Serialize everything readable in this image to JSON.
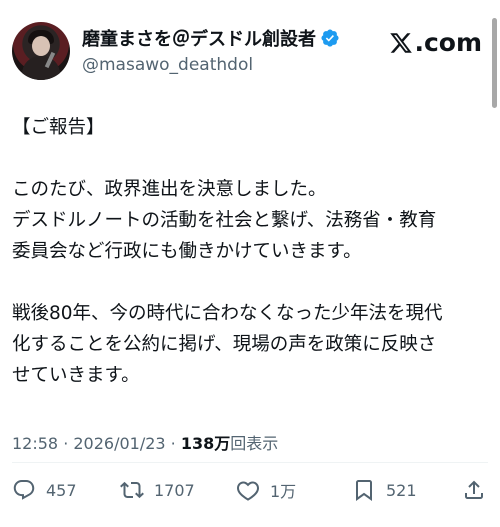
{
  "author": {
    "display_name": "磨童まさを＠デスドル創設者",
    "handle": "@masawo_deathdol",
    "verified_icon": "verified-badge-icon",
    "badge_color": "#1d9bf0"
  },
  "platform": {
    "logo_text": ".com"
  },
  "post": {
    "lines": [
      "【ご報告】",
      "",
      "このたび、政界進出を決意しました。",
      "デスドルノートの活動を社会と繋げ、法務省・教育",
      "委員会など行政にも働きかけていきます。",
      "",
      "戦後80年、今の時代に合わなくなった少年法を現代",
      "化することを公約に掲げ、現場の声を政策に反映さ",
      "せていきます。"
    ]
  },
  "meta": {
    "time": "12:58",
    "separator": " · ",
    "date": "2026/01/23",
    "views_count": "138万",
    "views_label": "回表示"
  },
  "actions": {
    "replies": "457",
    "reposts": "1707",
    "likes": "1万",
    "bookmarks": "521"
  },
  "colors": {
    "text": "#0f1419",
    "muted": "#536471",
    "accent": "#1d9bf0"
  }
}
